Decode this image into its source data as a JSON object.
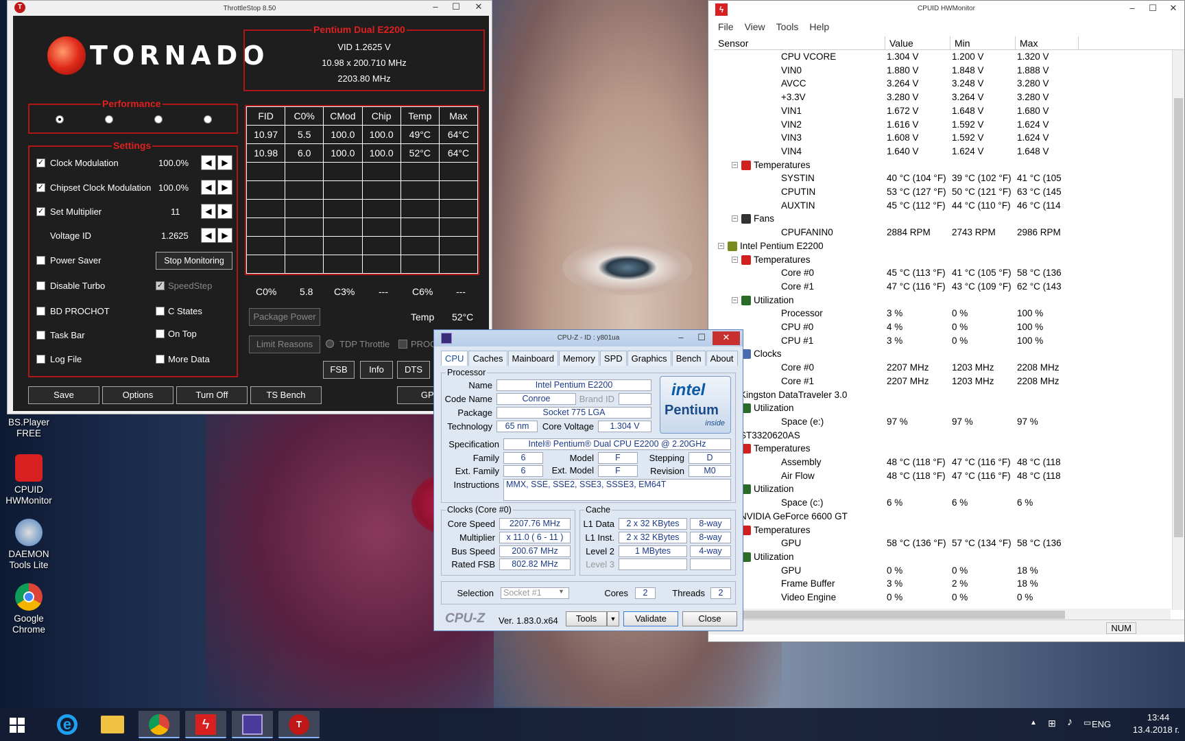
{
  "throttlestop": {
    "title": "ThrottleStop 8.50",
    "logo_text": "TORNADO",
    "cpu_name": "Pentium Dual E2200",
    "vid": "VID  1.2625 V",
    "multiplier_line": "10.98 x 200.710 MHz",
    "freq": "2203.80 MHz",
    "performance_label": "Performance",
    "settings_label": "Settings",
    "settings": [
      {
        "label": "Clock Modulation",
        "value": "100.0%",
        "checked": true
      },
      {
        "label": "Chipset Clock Modulation",
        "value": "100.0%",
        "checked": true
      },
      {
        "label": "Set Multiplier",
        "value": "11",
        "checked": true
      },
      {
        "label": "Voltage ID",
        "value": "1.2625"
      }
    ],
    "checks_left": [
      "Power Saver",
      "Disable Turbo",
      "BD PROCHOT",
      "Task Bar",
      "Log File"
    ],
    "checks_right": [
      "SpeedStep",
      "C States",
      "On Top",
      "More Data"
    ],
    "stop_monitoring": "Stop Monitoring",
    "grid_headers": [
      "FID",
      "C0%",
      "CMod",
      "Chip",
      "Temp",
      "Max"
    ],
    "grid_rows": [
      [
        "10.97",
        "5.5",
        "100.0",
        "100.0",
        "49°C",
        "64°C"
      ],
      [
        "10.98",
        "6.0",
        "100.0",
        "100.0",
        "52°C",
        "64°C"
      ]
    ],
    "cstate": [
      "C0%",
      "5.8",
      "C3%",
      "---",
      "C6%",
      "---"
    ],
    "package_power": "Package Power",
    "temp_label": "Temp",
    "temp_value": "52°C",
    "limit_reasons": "Limit Reasons",
    "tdp_throttle": "TDP Throttle",
    "prochot": "PROCHOT",
    "mid_buttons": [
      "FSB",
      "Info",
      "DTS"
    ],
    "bottom_buttons": [
      "Save",
      "Options",
      "Turn Off",
      "TS Bench",
      "GPU"
    ]
  },
  "hwmonitor": {
    "title": "CPUID HWMonitor",
    "menu": [
      "File",
      "View",
      "Tools",
      "Help"
    ],
    "columns": [
      "Sensor",
      "Value",
      "Min",
      "Max"
    ],
    "rows": [
      {
        "indent": 4,
        "name": "CPU VCORE",
        "value": "1.304 V",
        "min": "1.200 V",
        "max": "1.320 V"
      },
      {
        "indent": 4,
        "name": "VIN0",
        "value": "1.880 V",
        "min": "1.848 V",
        "max": "1.888 V"
      },
      {
        "indent": 4,
        "name": "AVCC",
        "value": "3.264 V",
        "min": "3.248 V",
        "max": "3.280 V"
      },
      {
        "indent": 4,
        "name": "+3.3V",
        "value": "3.280 V",
        "min": "3.264 V",
        "max": "3.280 V"
      },
      {
        "indent": 4,
        "name": "VIN1",
        "value": "1.672 V",
        "min": "1.648 V",
        "max": "1.680 V"
      },
      {
        "indent": 4,
        "name": "VIN2",
        "value": "1.616 V",
        "min": "1.592 V",
        "max": "1.624 V"
      },
      {
        "indent": 4,
        "name": "VIN3",
        "value": "1.608 V",
        "min": "1.592 V",
        "max": "1.624 V"
      },
      {
        "indent": 4,
        "name": "VIN4",
        "value": "1.640 V",
        "min": "1.624 V",
        "max": "1.648 V"
      },
      {
        "indent": 3,
        "name": "Temperatures",
        "value": "",
        "min": "",
        "max": "",
        "icon": "temperature-icon"
      },
      {
        "indent": 4,
        "name": "SYSTIN",
        "value": "40 °C  (104 °F)",
        "min": "39 °C  (102 °F)",
        "max": "41 °C  (105"
      },
      {
        "indent": 4,
        "name": "CPUTIN",
        "value": "53 °C  (127 °F)",
        "min": "50 °C  (121 °F)",
        "max": "63 °C  (145"
      },
      {
        "indent": 4,
        "name": "AUXTIN",
        "value": "45 °C  (112 °F)",
        "min": "44 °C  (110 °F)",
        "max": "46 °C  (114"
      },
      {
        "indent": 3,
        "name": "Fans",
        "value": "",
        "min": "",
        "max": "",
        "icon": "fan-icon"
      },
      {
        "indent": 4,
        "name": "CPUFANIN0",
        "value": "2884 RPM",
        "min": "2743 RPM",
        "max": "2986 RPM"
      },
      {
        "indent": 2,
        "name": "Intel Pentium E2200",
        "value": "",
        "min": "",
        "max": "",
        "icon": "cpu-icon"
      },
      {
        "indent": 3,
        "name": "Temperatures",
        "value": "",
        "min": "",
        "max": "",
        "icon": "temperature-icon"
      },
      {
        "indent": 4,
        "name": "Core #0",
        "value": "45 °C  (113 °F)",
        "min": "41 °C  (105 °F)",
        "max": "58 °C  (136"
      },
      {
        "indent": 4,
        "name": "Core #1",
        "value": "47 °C  (116 °F)",
        "min": "43 °C  (109 °F)",
        "max": "62 °C  (143"
      },
      {
        "indent": 3,
        "name": "Utilization",
        "value": "",
        "min": "",
        "max": "",
        "icon": "utilization-icon"
      },
      {
        "indent": 4,
        "name": "Processor",
        "value": "3 %",
        "min": "0 %",
        "max": "100 %"
      },
      {
        "indent": 4,
        "name": "CPU #0",
        "value": "4 %",
        "min": "0 %",
        "max": "100 %"
      },
      {
        "indent": 4,
        "name": "CPU #1",
        "value": "3 %",
        "min": "0 %",
        "max": "100 %"
      },
      {
        "indent": 3,
        "name": "Clocks",
        "value": "",
        "min": "",
        "max": "",
        "icon": "clock-icon"
      },
      {
        "indent": 4,
        "name": "Core #0",
        "value": "2207 MHz",
        "min": "1203 MHz",
        "max": "2208 MHz"
      },
      {
        "indent": 4,
        "name": "Core #1",
        "value": "2207 MHz",
        "min": "1203 MHz",
        "max": "2208 MHz"
      },
      {
        "indent": 2,
        "name": "Kingston DataTraveler 3.0",
        "value": "",
        "min": "",
        "max": "",
        "icon": "drive-icon"
      },
      {
        "indent": 3,
        "name": "Utilization",
        "value": "",
        "min": "",
        "max": "",
        "icon": "utilization-icon"
      },
      {
        "indent": 4,
        "name": "Space (e:)",
        "value": "97 %",
        "min": "97 %",
        "max": "97 %"
      },
      {
        "indent": 2,
        "name": "ST3320620AS",
        "value": "",
        "min": "",
        "max": "",
        "icon": "drive-icon"
      },
      {
        "indent": 3,
        "name": "Temperatures",
        "value": "",
        "min": "",
        "max": "",
        "icon": "temperature-icon"
      },
      {
        "indent": 4,
        "name": "Assembly",
        "value": "48 °C  (118 °F)",
        "min": "47 °C  (116 °F)",
        "max": "48 °C  (118"
      },
      {
        "indent": 4,
        "name": "Air Flow",
        "value": "48 °C  (118 °F)",
        "min": "47 °C  (116 °F)",
        "max": "48 °C  (118"
      },
      {
        "indent": 3,
        "name": "Utilization",
        "value": "",
        "min": "",
        "max": "",
        "icon": "utilization-icon"
      },
      {
        "indent": 4,
        "name": "Space (c:)",
        "value": "6 %",
        "min": "6 %",
        "max": "6 %"
      },
      {
        "indent": 2,
        "name": "NVIDIA GeForce 6600 GT",
        "value": "",
        "min": "",
        "max": "",
        "icon": "gpu-icon"
      },
      {
        "indent": 3,
        "name": "Temperatures",
        "value": "",
        "min": "",
        "max": "",
        "icon": "temperature-icon"
      },
      {
        "indent": 4,
        "name": "GPU",
        "value": "58 °C  (136 °F)",
        "min": "57 °C  (134 °F)",
        "max": "58 °C  (136"
      },
      {
        "indent": 3,
        "name": "Utilization",
        "value": "",
        "min": "",
        "max": "",
        "icon": "utilization-icon"
      },
      {
        "indent": 4,
        "name": "GPU",
        "value": "0 %",
        "min": "0 %",
        "max": "18 %"
      },
      {
        "indent": 4,
        "name": "Frame Buffer",
        "value": "3 %",
        "min": "2 %",
        "max": "18 %"
      },
      {
        "indent": 4,
        "name": "Video Engine",
        "value": "0 %",
        "min": "0 %",
        "max": "0 %"
      }
    ],
    "status_num": "NUM"
  },
  "cpuz": {
    "title": "CPU-Z - ID : y801ua",
    "tabs": [
      "CPU",
      "Caches",
      "Mainboard",
      "Memory",
      "SPD",
      "Graphics",
      "Bench",
      "About"
    ],
    "processor_label": "Processor",
    "name_label": "Name",
    "name": "Intel Pentium E2200",
    "codename_label": "Code Name",
    "codename": "Conroe",
    "brandid_label": "Brand ID",
    "package_label": "Package",
    "package": "Socket 775 LGA",
    "technology_label": "Technology",
    "technology": "65 nm",
    "corevoltage_label": "Core Voltage",
    "corevoltage": "1.304 V",
    "spec_label": "Specification",
    "spec": "Intel® Pentium® Dual  CPU  E2200  @ 2.20GHz",
    "family_label": "Family",
    "family": "6",
    "model_label": "Model",
    "model": "F",
    "stepping_label": "Stepping",
    "stepping": "D",
    "extfamily_label": "Ext. Family",
    "extfamily": "6",
    "extmodel_label": "Ext. Model",
    "extmodel": "F",
    "revision_label": "Revision",
    "revision": "M0",
    "instructions_label": "Instructions",
    "instructions": "MMX, SSE, SSE2, SSE3, SSSE3, EM64T",
    "clocks_label": "Clocks (Core #0)",
    "corespeed_label": "Core Speed",
    "corespeed": "2207.76 MHz",
    "multiplier_label": "Multiplier",
    "multiplier": "x 11.0 ( 6 - 11 )",
    "busspeed_label": "Bus Speed",
    "busspeed": "200.67 MHz",
    "ratedfsb_label": "Rated FSB",
    "ratedfsb": "802.82 MHz",
    "cache_label": "Cache",
    "l1d_label": "L1 Data",
    "l1d": "2 x 32 KBytes",
    "l1d_way": "8-way",
    "l1i_label": "L1 Inst.",
    "l1i": "2 x 32 KBytes",
    "l1i_way": "8-way",
    "l2_label": "Level 2",
    "l2": "1 MBytes",
    "l2_way": "4-way",
    "l3_label": "Level 3",
    "selection_label": "Selection",
    "selection": "Socket #1",
    "cores_label": "Cores",
    "cores": "2",
    "threads_label": "Threads",
    "threads": "2",
    "brand": "CPU-Z",
    "version": "Ver. 1.83.0.x64",
    "tools_btn": "Tools",
    "validate_btn": "Validate",
    "close_btn": "Close",
    "intel_logo": "intel",
    "pentium_logo": "Pentium",
    "inside": "inside"
  },
  "desktop_icons": [
    {
      "label": "BS.Player FREE"
    },
    {
      "label": "CPUID HWMonitor"
    },
    {
      "label": "DAEMON Tools Lite"
    },
    {
      "label": "Google Chrome"
    }
  ],
  "taskbar": {
    "lang": "ENG",
    "time": "13:44",
    "date": "13.4.2018 г."
  }
}
